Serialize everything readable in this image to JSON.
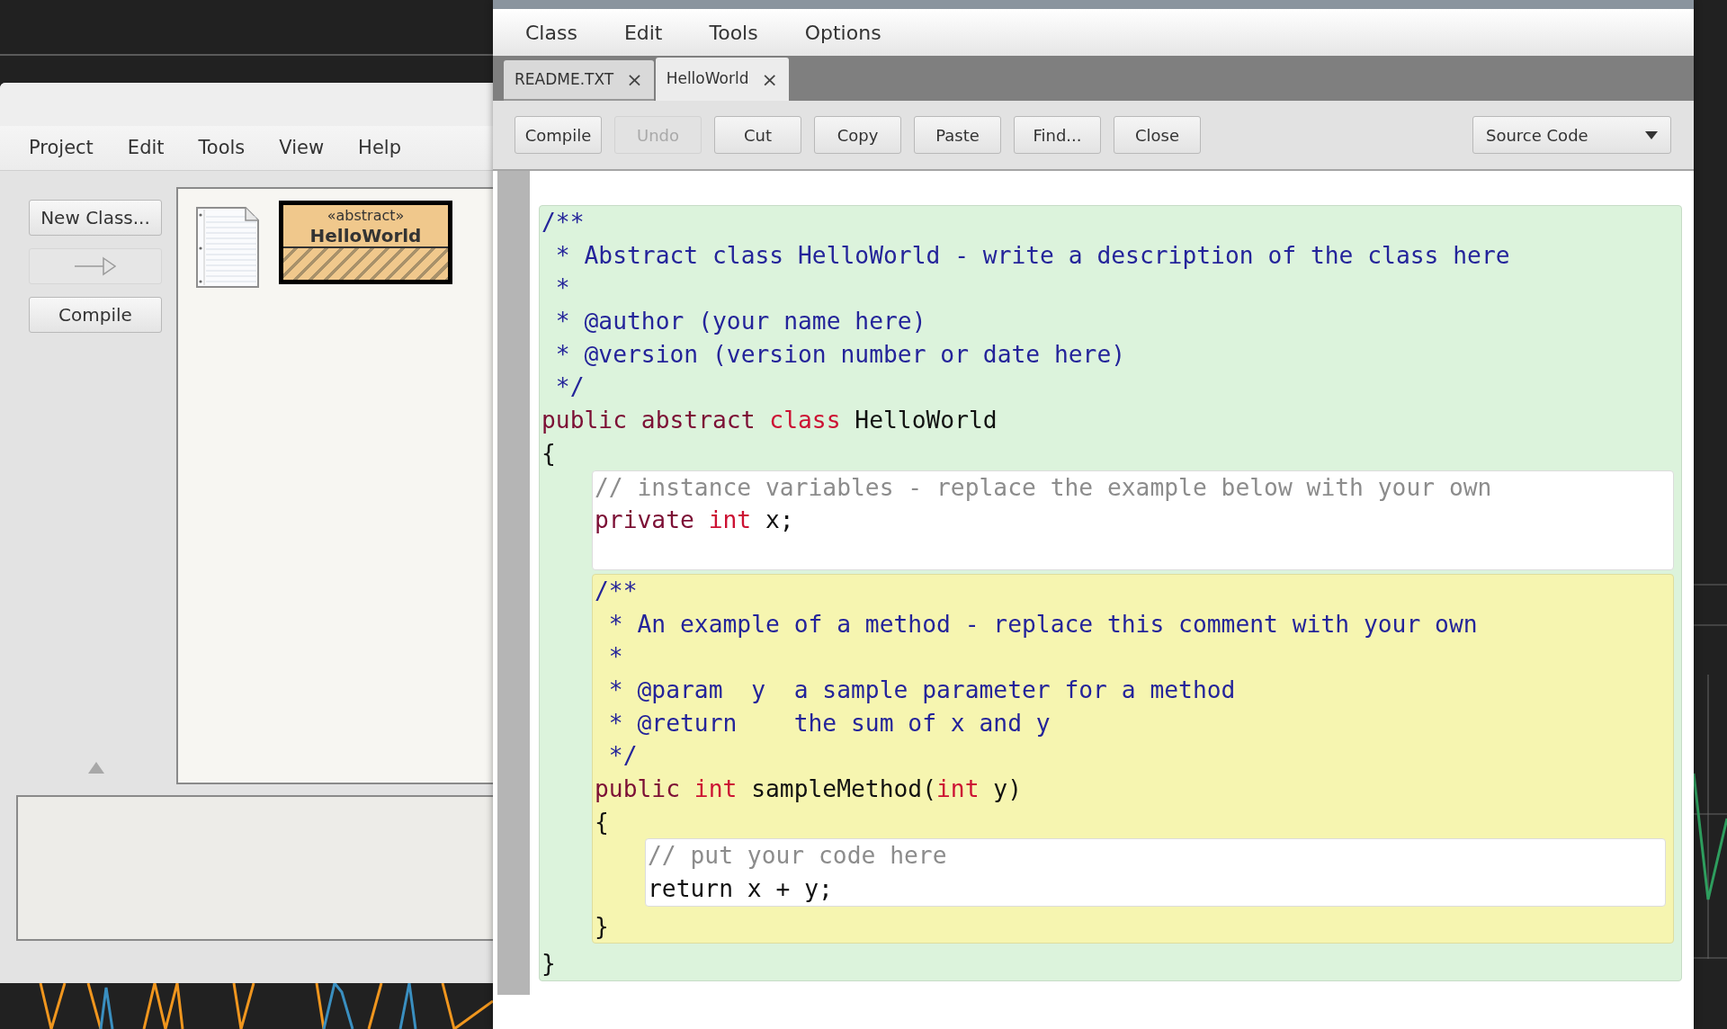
{
  "project_window": {
    "menu": [
      "Project",
      "Edit",
      "Tools",
      "View",
      "Help"
    ],
    "buttons": [
      {
        "kind": "text",
        "label": "New Class...",
        "disabled": false
      },
      {
        "kind": "arrow",
        "disabled": true
      },
      {
        "kind": "text",
        "label": "Compile",
        "disabled": false
      }
    ],
    "diagram": [
      {
        "kind": "text_file"
      },
      {
        "kind": "class",
        "stereotype": "«abstract»",
        "name": "HelloWorld"
      }
    ]
  },
  "editor_window": {
    "menu": [
      "Class",
      "Edit",
      "Tools",
      "Options"
    ],
    "tabs": [
      {
        "label": "README.TXT",
        "close": "×",
        "selected": false
      },
      {
        "label": "HelloWorld",
        "close": "×",
        "selected": true
      }
    ],
    "toolbar": [
      {
        "label": "Compile",
        "disabled": false
      },
      {
        "label": "Undo",
        "disabled": true
      },
      {
        "label": "Cut",
        "disabled": false
      },
      {
        "label": "Copy",
        "disabled": false
      },
      {
        "label": "Paste",
        "disabled": false
      },
      {
        "label": "Find...",
        "disabled": false
      },
      {
        "label": "Close",
        "disabled": false
      }
    ],
    "view_selector": "Source Code",
    "code": {
      "kind": "class",
      "lines": [
        [
          {
            "kind": "doc",
            "text": "/**"
          }
        ],
        [
          {
            "kind": "doc",
            "text": " * Abstract class HelloWorld - write a description of the class here"
          }
        ],
        [
          {
            "kind": "doc",
            "text": " *"
          }
        ],
        [
          {
            "kind": "doc",
            "text": " * @author (your name here)"
          }
        ],
        [
          {
            "kind": "doc",
            "text": " * @version (version number or date here)"
          }
        ],
        [
          {
            "kind": "doc",
            "text": " */"
          }
        ],
        [
          {
            "kind": "keyword",
            "text": "public abstract "
          },
          {
            "kind": "type",
            "text": "class"
          },
          {
            "kind": "plain",
            "text": " HelloWorld"
          }
        ],
        [
          {
            "kind": "plain",
            "text": "{"
          }
        ]
      ],
      "children": [
        {
          "kind": "field",
          "lines": [
            [
              {
                "kind": "comment",
                "text": "// instance variables - replace the example below with your own"
              }
            ],
            [
              {
                "kind": "keyword",
                "text": "private "
              },
              {
                "kind": "type",
                "text": "int"
              },
              {
                "kind": "plain",
                "text": " x;"
              }
            ]
          ]
        },
        {
          "kind": "method",
          "lines": [
            [
              {
                "kind": "doc",
                "text": "/**"
              }
            ],
            [
              {
                "kind": "doc",
                "text": " * An example of a method - replace this comment with your own"
              }
            ],
            [
              {
                "kind": "doc",
                "text": " *"
              }
            ],
            [
              {
                "kind": "doc",
                "text": " * @param  y  a sample parameter for a method"
              }
            ],
            [
              {
                "kind": "doc",
                "text": " * @return    the sum of x and y"
              }
            ],
            [
              {
                "kind": "doc",
                "text": " */"
              }
            ],
            [
              {
                "kind": "keyword",
                "text": "public "
              },
              {
                "kind": "type",
                "text": "int"
              },
              {
                "kind": "plain",
                "text": " sampleMethod("
              },
              {
                "kind": "type",
                "text": "int"
              },
              {
                "kind": "plain",
                "text": " y)"
              }
            ],
            [
              {
                "kind": "plain",
                "text": "{"
              }
            ]
          ],
          "children": [
            {
              "kind": "body",
              "lines": [
                [
                  {
                    "kind": "comment",
                    "text": "// put your code here"
                  }
                ],
                [
                  {
                    "kind": "plain",
                    "text": "return x + y;"
                  }
                ]
              ]
            }
          ],
          "closing": [
            [
              {
                "kind": "plain",
                "text": "}"
              }
            ]
          ]
        }
      ],
      "closing": [
        [
          {
            "kind": "plain",
            "text": "}"
          }
        ]
      ]
    }
  }
}
